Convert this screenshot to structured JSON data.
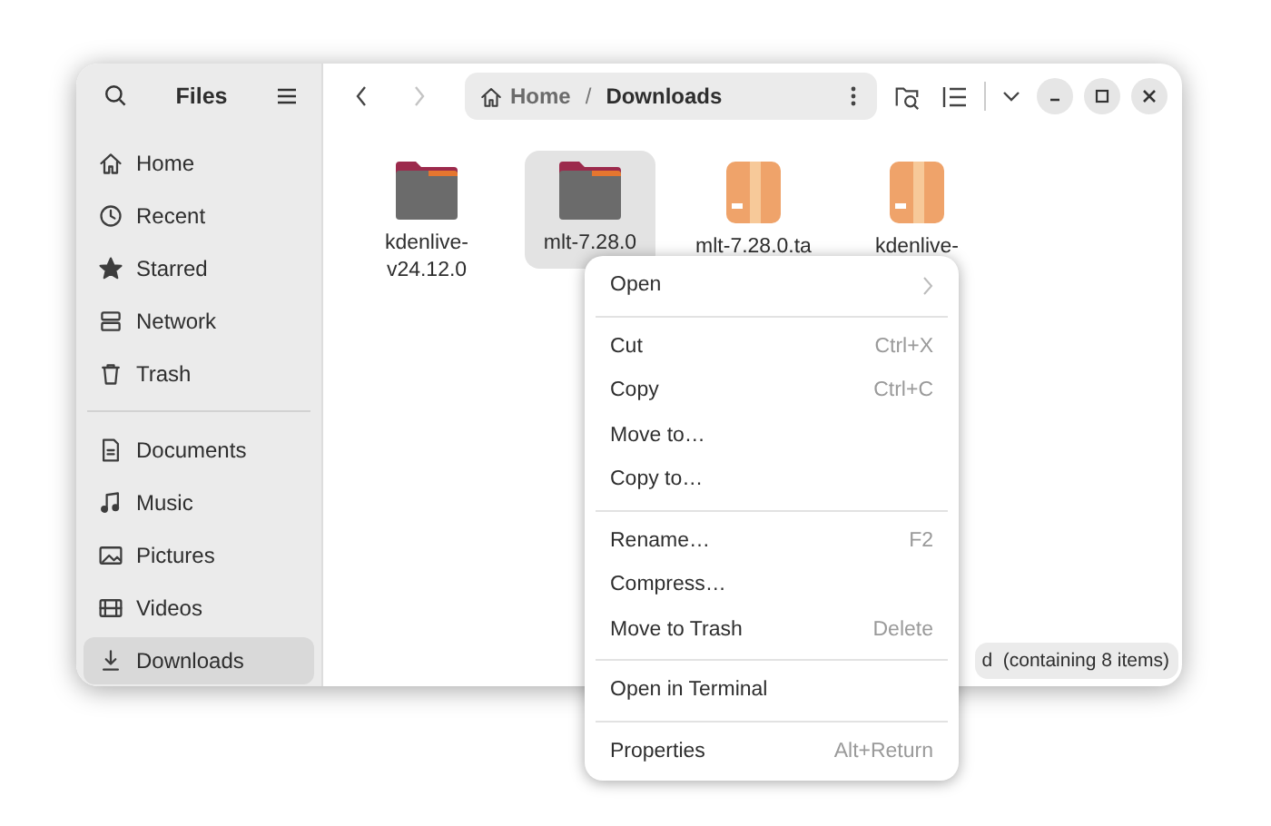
{
  "sidebar": {
    "title": "Files",
    "places": [
      {
        "label": "Home",
        "selected": false
      },
      {
        "label": "Recent",
        "selected": false
      },
      {
        "label": "Starred",
        "selected": false
      },
      {
        "label": "Network",
        "selected": false
      },
      {
        "label": "Trash",
        "selected": false
      }
    ],
    "bookmarks": [
      {
        "label": "Documents",
        "selected": false
      },
      {
        "label": "Music",
        "selected": false
      },
      {
        "label": "Pictures",
        "selected": false
      },
      {
        "label": "Videos",
        "selected": false
      },
      {
        "label": "Downloads",
        "selected": true
      }
    ]
  },
  "toolbar": {
    "back_disabled": false,
    "forward_disabled": true,
    "path": [
      {
        "label": "Home",
        "current": false
      },
      {
        "label": "Downloads",
        "current": true
      }
    ],
    "separator": "/"
  },
  "files": [
    {
      "name": "kdenlive-\nv24.12.0",
      "kind": "folder",
      "selected": false
    },
    {
      "name": "mlt-7.28.0",
      "kind": "folder",
      "selected": true
    },
    {
      "name": "mlt-7.28.0.ta",
      "kind": "archive",
      "selected": false
    },
    {
      "name": "kdenlive-",
      "kind": "archive",
      "selected": false
    }
  ],
  "status": "d  (containing 8 items)",
  "context_menu": [
    [
      {
        "label": "Open",
        "submenu": true
      }
    ],
    [
      {
        "label": "Cut",
        "shortcut": "Ctrl+X"
      },
      {
        "label": "Copy",
        "shortcut": "Ctrl+C"
      },
      {
        "label": "Move to…"
      },
      {
        "label": "Copy to…"
      }
    ],
    [
      {
        "label": "Rename…",
        "shortcut": "F2"
      },
      {
        "label": "Compress…"
      },
      {
        "label": "Move to Trash",
        "shortcut": "Delete"
      }
    ],
    [
      {
        "label": "Open in Terminal"
      }
    ],
    [
      {
        "label": "Properties",
        "shortcut": "Alt+Return"
      }
    ]
  ]
}
